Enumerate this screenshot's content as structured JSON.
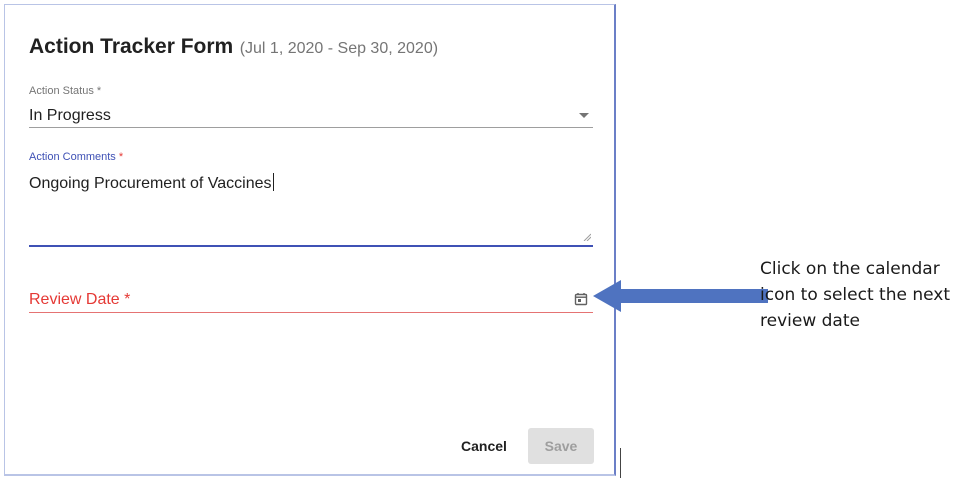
{
  "form": {
    "title": "Action Tracker Form",
    "period": "(Jul 1, 2020 - Sep 30, 2020)",
    "action_status": {
      "label": "Action Status *",
      "value": "In Progress"
    },
    "action_comments": {
      "label": "Action Comments",
      "required_mark": "*",
      "value": "Ongoing Procurement of Vaccines"
    },
    "review_date": {
      "label": "Review Date *",
      "icon": "calendar-icon"
    },
    "buttons": {
      "cancel": "Cancel",
      "save": "Save"
    }
  },
  "annotation": {
    "text": "Click on the calendar icon to select the next review date",
    "arrow_color": "#4f73c0"
  },
  "colors": {
    "accent": "#3f51b5",
    "error": "#e53935"
  }
}
